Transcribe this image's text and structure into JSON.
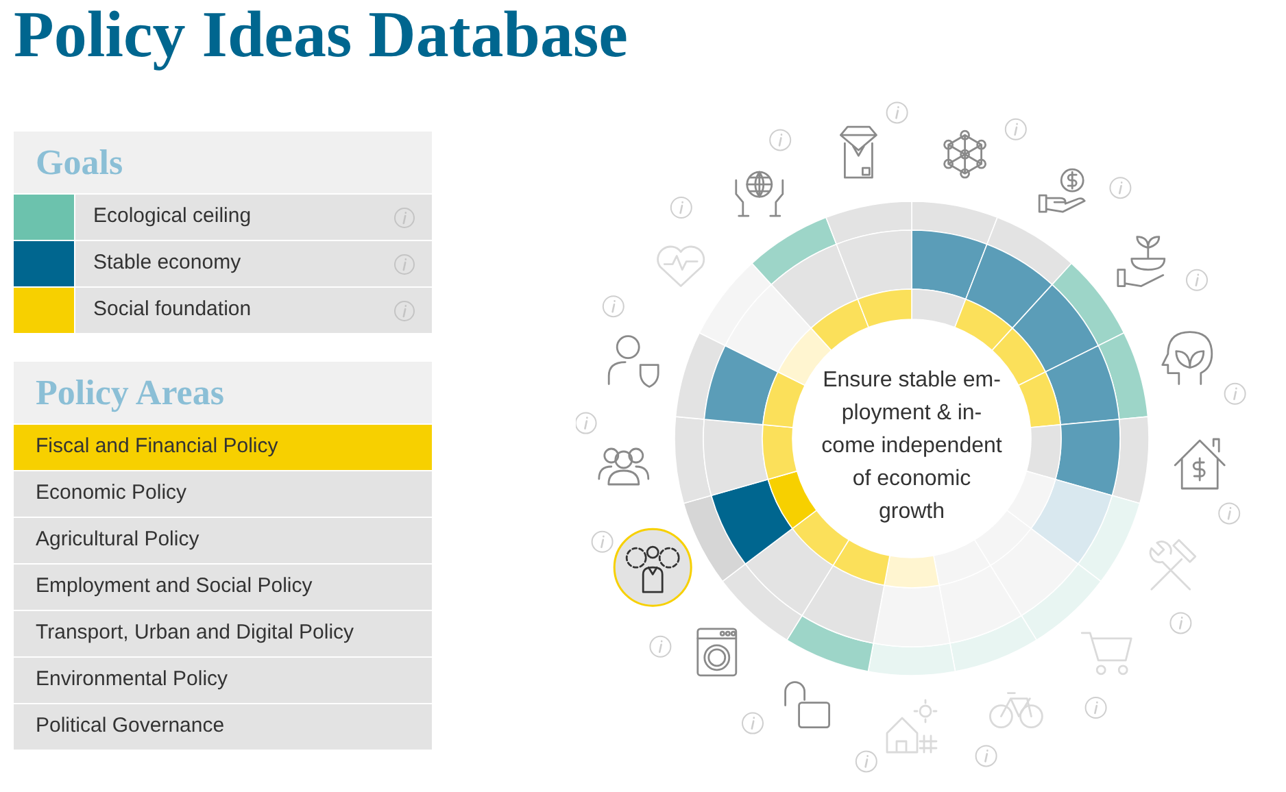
{
  "title": "Policy Ideas Database",
  "goals": {
    "heading": "Goals",
    "items": [
      {
        "label": "Ecological ceiling",
        "color": "#6cc2ad"
      },
      {
        "label": "Stable economy",
        "color": "#00668f"
      },
      {
        "label": "Social foundation",
        "color": "#f7d000"
      }
    ]
  },
  "policy_areas": {
    "heading": "Policy Areas",
    "items": [
      {
        "label": "Fiscal and Financial Policy",
        "selected": true
      },
      {
        "label": "Economic Policy",
        "selected": false
      },
      {
        "label": "Agricultural Policy",
        "selected": false
      },
      {
        "label": "Employment and Social Policy",
        "selected": false
      },
      {
        "label": "Transport, Urban and Digital Policy",
        "selected": false
      },
      {
        "label": "Environmental Policy",
        "selected": false
      },
      {
        "label": "Political Governance",
        "selected": false
      }
    ]
  },
  "wheel": {
    "center_text_lines": [
      "Ensure stable em-",
      "ployment & in-",
      "come independent",
      "of economic",
      "growth"
    ],
    "sectors": [
      {
        "ecological": false,
        "economic": true,
        "social": false,
        "faded": false,
        "selected": false
      },
      {
        "ecological": false,
        "economic": true,
        "social": true,
        "faded": false,
        "selected": false
      },
      {
        "ecological": true,
        "economic": true,
        "social": true,
        "faded": false,
        "selected": false
      },
      {
        "ecological": true,
        "economic": true,
        "social": true,
        "faded": false,
        "selected": false
      },
      {
        "ecological": false,
        "economic": true,
        "social": false,
        "faded": false,
        "selected": false
      },
      {
        "ecological": true,
        "economic": true,
        "social": false,
        "faded": true,
        "selected": false
      },
      {
        "ecological": true,
        "economic": false,
        "social": false,
        "faded": true,
        "selected": false
      },
      {
        "ecological": true,
        "economic": false,
        "social": false,
        "faded": true,
        "selected": false
      },
      {
        "ecological": true,
        "economic": false,
        "social": true,
        "faded": true,
        "selected": false
      },
      {
        "ecological": true,
        "economic": false,
        "social": true,
        "faded": false,
        "selected": false
      },
      {
        "ecological": false,
        "economic": false,
        "social": true,
        "faded": false,
        "selected": false
      },
      {
        "ecological": false,
        "economic": true,
        "social": true,
        "faded": false,
        "selected": true
      },
      {
        "ecological": false,
        "economic": false,
        "social": true,
        "faded": false,
        "selected": false
      },
      {
        "ecological": false,
        "economic": true,
        "social": true,
        "faded": false,
        "selected": false
      },
      {
        "ecological": false,
        "economic": false,
        "social": true,
        "faded": true,
        "selected": false
      },
      {
        "ecological": true,
        "economic": false,
        "social": true,
        "faded": false,
        "selected": false
      },
      {
        "ecological": false,
        "economic": false,
        "social": true,
        "faded": false,
        "selected": false
      }
    ]
  }
}
